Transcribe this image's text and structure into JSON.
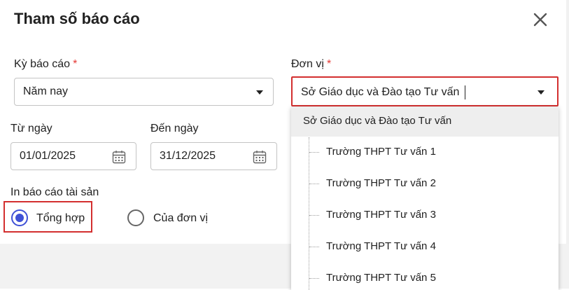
{
  "dialog": {
    "title": "Tham số báo cáo",
    "close_icon": "close-icon"
  },
  "period": {
    "label": "Kỳ báo cáo",
    "required_mark": "*",
    "value": "Năm nay"
  },
  "unit": {
    "label": "Đơn vị",
    "required_mark": "*",
    "value": "Sở Giáo dục và Đào tạo Tư vấn"
  },
  "date_from": {
    "label": "Từ ngày",
    "value": "01/01/2025",
    "icon": "calendar-icon"
  },
  "date_to": {
    "label": "Đến ngày",
    "value": "31/12/2025",
    "icon": "calendar-icon"
  },
  "print_option": {
    "label": "In báo cáo tài sản",
    "options": [
      {
        "label": "Tổng hợp",
        "selected": true
      },
      {
        "label": "Của đơn vị",
        "selected": false
      }
    ]
  },
  "unit_dropdown": {
    "root": "Sở Giáo dục và Đào tạo Tư vấn",
    "children": [
      "Trường THPT Tư vấn 1",
      "Trường THPT Tư vấn 2",
      "Trường THPT Tư vấn 3",
      "Trường THPT Tư vấn 4",
      "Trường THPT Tư vấn 5"
    ]
  },
  "colors": {
    "accent": "#3f51d6",
    "required": "#e53935",
    "highlight_border": "#d32f2f"
  }
}
